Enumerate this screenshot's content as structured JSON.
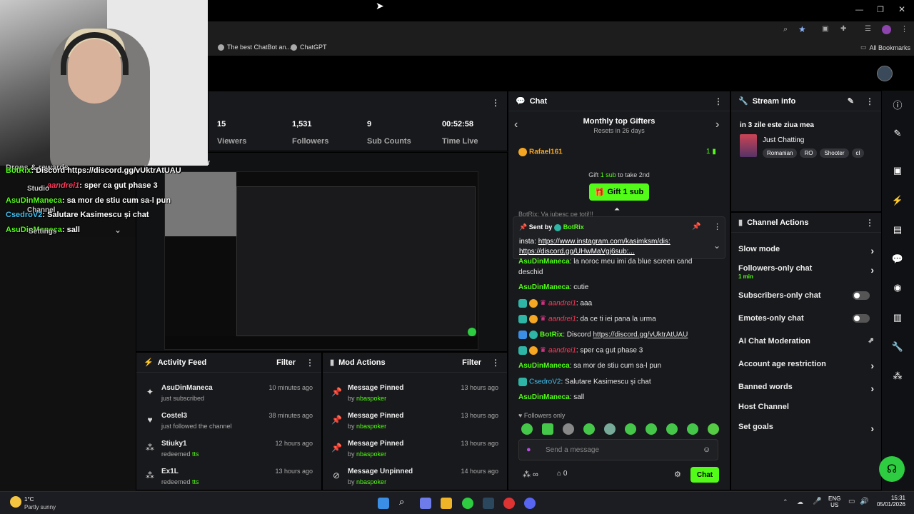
{
  "browser": {
    "bookmarks": [
      {
        "label": "The best ChatBot an..."
      },
      {
        "label": "ChatGPT"
      }
    ],
    "all_bookmarks": "All Bookmarks"
  },
  "stats": [
    {
      "value": "15",
      "label": "Viewers"
    },
    {
      "value": "1,531",
      "label": "Followers"
    },
    {
      "value": "9",
      "label": "Sub Counts"
    },
    {
      "value": "00:52:58",
      "label": "Time Live"
    }
  ],
  "stream_preview": {
    "label": "Stream Preview"
  },
  "overlay": {
    "menu": [
      "Drops & rewards",
      "Studio",
      "Channel",
      "Settings"
    ],
    "messages": [
      {
        "user": "BotRix",
        "text": "Discord https://discord.gg/vUktrAtUAU"
      },
      {
        "user": "aandrei1",
        "text": "sper ca gut phase 3"
      },
      {
        "user": "AsuDinManeca",
        "text": "sa mor de stiu cum sa-l pun"
      },
      {
        "user": "CsedroV2",
        "text": "Salutare Kasimescu și chat"
      },
      {
        "user": "AsuDinManeca",
        "text": "sall"
      }
    ]
  },
  "activity_feed": {
    "title": "Activity Feed",
    "filter": "Filter",
    "items": [
      {
        "name": "AsuDinManeca",
        "sub": "just subscribed",
        "time": "10 minutes ago",
        "icon": "sparkle-icon"
      },
      {
        "name": "Costel3",
        "sub": "just followed the channel",
        "time": "38 minutes ago",
        "icon": "heart-icon"
      },
      {
        "name": "Stiuky1",
        "sub_prefix": "redeemed",
        "sub_hl": "tts",
        "time": "12 hours ago",
        "icon": "points-icon"
      },
      {
        "name": "Ex1L",
        "sub_prefix": "redeemed",
        "sub_hl": "tts",
        "time": "13 hours ago",
        "icon": "points-icon"
      }
    ]
  },
  "mod_actions": {
    "title": "Mod Actions",
    "filter": "Filter",
    "items": [
      {
        "action": "Message Pinned",
        "by": "by",
        "mod": "nbaspoker",
        "time": "13 hours ago"
      },
      {
        "action": "Message Pinned",
        "by": "by",
        "mod": "nbaspoker",
        "time": "13 hours ago"
      },
      {
        "action": "Message Pinned",
        "by": "by",
        "mod": "nbaspoker",
        "time": "13 hours ago"
      },
      {
        "action": "Message Unpinned",
        "by": "by",
        "mod": "nbaspoker",
        "time": "14 hours ago"
      }
    ]
  },
  "chat": {
    "title": "Chat",
    "gifters_title": "Monthly top Gifters",
    "gifters_reset": "Resets in 26 days",
    "top_gifter": "Rafael161",
    "top_gifter_count": "1",
    "gift_prompt_pre": "Gift",
    "gift_prompt_count": "1 sub",
    "gift_prompt_post": "to take 2nd",
    "gift_button": "Gift 1 sub",
    "pinned_sent_by": "Sent by",
    "pinned_user": "BotRix",
    "pinned_line1_pre": "insta: ",
    "pinned_line1_link": "https://www.instagram.com/kasimksm/dis:",
    "pinned_line2_link": "https://discord.gg/UHwMaVgj6sub;...",
    "partial_top": "BotRix: Va iubesc pe toti!!!",
    "messages": [
      {
        "user": "AsuDinManeca",
        "text": "la noroc meu imi da blue screen cand"
      },
      {
        "user": "",
        "text": "deschid"
      },
      {
        "user": "AsuDinManeca",
        "text": "cutie"
      },
      {
        "user": "aandrei1",
        "text": "aaa"
      },
      {
        "user": "aandrei1",
        "text": "da ce ti iei pana la urma"
      },
      {
        "user": "BotRix",
        "text": "Discord ",
        "link": "https://discord.gg/vUktrAtUAU"
      },
      {
        "user": "aandrei1",
        "text": "sper ca gut phase 3"
      },
      {
        "user": "AsuDinManeca",
        "text": "sa mor de stiu cum sa-l pun"
      },
      {
        "user": "CsedroV2",
        "text": "Salutare Kasimescu și chat"
      },
      {
        "user": "AsuDinManeca",
        "text": "sall"
      }
    ],
    "followers_only": "Followers only",
    "input_placeholder": "Send a message",
    "points": "0",
    "send_button": "Chat"
  },
  "stream_info": {
    "title": "Stream info",
    "stream_title": "in 3 zile este ziua mea",
    "category": "Just Chatting",
    "tags": [
      "Romanian",
      "RO",
      "Shooter",
      "cl"
    ]
  },
  "channel_actions": {
    "title": "Channel Actions",
    "items": [
      {
        "label": "Slow mode",
        "control": "chevron"
      },
      {
        "label": "Followers-only chat",
        "sub": "1 min",
        "control": "chevron"
      },
      {
        "label": "Subscribers-only chat",
        "control": "toggle"
      },
      {
        "label": "Emotes-only chat",
        "control": "toggle"
      },
      {
        "label": "AI Chat Moderation",
        "control": "external"
      },
      {
        "label": "Account age restriction",
        "control": "chevron"
      },
      {
        "label": "Banned words",
        "control": "chevron"
      },
      {
        "label": "Host Channel",
        "control": "none"
      },
      {
        "label": "Set goals",
        "control": "chevron"
      }
    ]
  },
  "taskbar": {
    "weather_temp": "1°C",
    "weather_desc": "Partly sunny",
    "lang": "ENG",
    "region": "US",
    "time": "15:31",
    "date": "05/01/2026"
  },
  "colors": {
    "accent": "#53fc18",
    "panel": "#18191c",
    "mention": "#ff3b5c"
  }
}
